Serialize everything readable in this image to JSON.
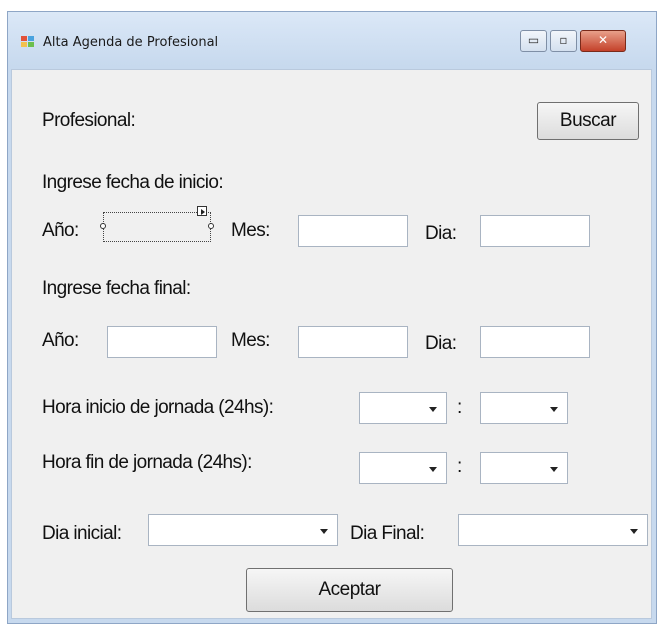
{
  "window": {
    "title": "Alta Agenda de Profesional"
  },
  "controls": {
    "minimize": "▭",
    "maximize": "▫",
    "close": "✕"
  },
  "form": {
    "profesional_label": "Profesional:",
    "buscar_button": "Buscar",
    "inicio_heading": "Ingrese fecha de inicio:",
    "final_heading": "Ingrese fecha final:",
    "anio_label": "Año:",
    "mes_label": "Mes:",
    "dia_label": "Dia:",
    "colon": ":",
    "hora_inicio_label": "Hora inicio de jornada (24hs):",
    "hora_fin_label": "Hora fin de jornada (24hs):",
    "dia_inicial_label": "Dia inicial:",
    "dia_final_label": "Dia Final:",
    "aceptar_button": "Aceptar"
  },
  "icons": [
    "window-icon",
    "dropdown-arrow-icon",
    "smart-tag-icon"
  ]
}
